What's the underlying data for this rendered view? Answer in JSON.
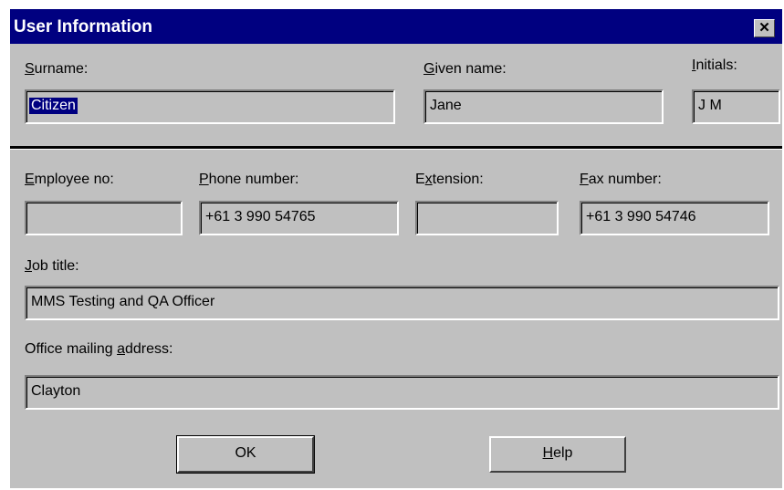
{
  "window": {
    "title": "User Information",
    "close_glyph": "✕"
  },
  "labels": {
    "surname": {
      "before": "",
      "mnemonic": "S",
      "after": "urname:"
    },
    "given_name": {
      "before": "",
      "mnemonic": "G",
      "after": "iven name:"
    },
    "initials": {
      "before": "",
      "mnemonic": "I",
      "after": "nitials:"
    },
    "employee_no": {
      "before": "",
      "mnemonic": "E",
      "after": "mployee no:"
    },
    "phone_number": {
      "before": "",
      "mnemonic": "P",
      "after": "hone number:"
    },
    "extension": {
      "before": "E",
      "mnemonic": "x",
      "after": "tension:"
    },
    "fax_number": {
      "before": "",
      "mnemonic": "F",
      "after": "ax number:"
    },
    "job_title": {
      "before": "",
      "mnemonic": "J",
      "after": "ob title:"
    },
    "office_address": {
      "before": "Office mailing ",
      "mnemonic": "a",
      "after": "ddress:"
    }
  },
  "fields": {
    "surname": "Citizen",
    "given_name": "Jane",
    "initials": "J M",
    "employee_no": "",
    "phone_number": "+61 3 990 54765",
    "extension": "",
    "fax_number": "+61 3 990 54746",
    "job_title": "MMS Testing and QA Officer",
    "office_address": "Clayton"
  },
  "buttons": {
    "ok": {
      "before": "OK",
      "mnemonic": "",
      "after": ""
    },
    "help": {
      "before": "",
      "mnemonic": "H",
      "after": "elp"
    }
  },
  "colors": {
    "titlebar": "#000080",
    "dialog_bg": "#c0c0c0",
    "selection": "#000080"
  }
}
